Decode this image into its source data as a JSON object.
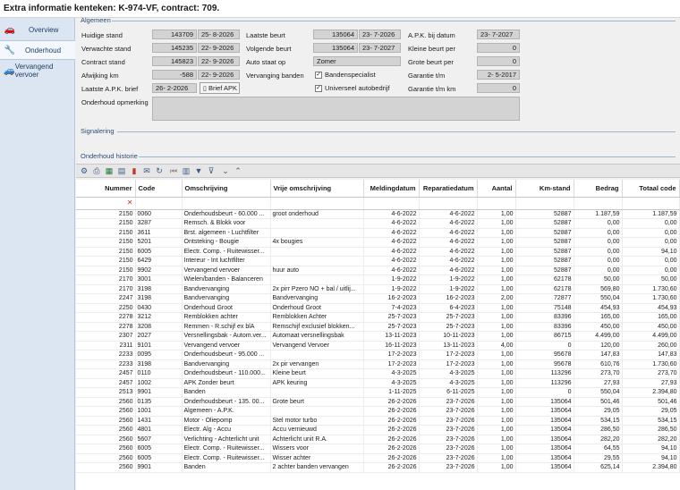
{
  "window": {
    "title": "Extra informatie kenteken: K-974-VF, contract: 709."
  },
  "sidebar": {
    "items": [
      {
        "label": "Overview",
        "icon": "car-icon"
      },
      {
        "label": "Onderhoud",
        "icon": "wrench-icon"
      },
      {
        "label": "Vervangend vervoer",
        "icon": "car-swap-icon"
      }
    ]
  },
  "algemeen": {
    "title": "Algemeen",
    "huidige_stand": {
      "label": "Huidige stand",
      "value": "143709",
      "date": "25- 8-2026"
    },
    "verwachte_stand": {
      "label": "Verwachte stand",
      "value": "145235",
      "date": "22- 9-2026"
    },
    "contract_stand": {
      "label": "Contract stand",
      "value": "145823",
      "date": "22- 9-2026"
    },
    "afwijking_km": {
      "label": "Afwijking km",
      "value": "-588",
      "date": "22- 9-2026"
    },
    "laatste_apk_brief": {
      "label": "Laatste A.P.K. brief",
      "date": "26- 2-2026",
      "button": "Brief APK"
    },
    "laatste_beurt": {
      "label": "Laatste beurt",
      "value": "135064",
      "date": "23- 7-2026"
    },
    "volgende_beurt": {
      "label": "Volgende beurt",
      "value": "135064",
      "date": "23- 7-2027"
    },
    "auto_staat_op": {
      "label": "Auto staat op",
      "value": "Zomer"
    },
    "vervanging_banden": {
      "label": "Vervanging banden",
      "bandenspecialist": "Bandenspecialist",
      "universeel": "Universeel autobedrijf"
    },
    "apk_bij_datum": {
      "label": "A.P.K. bij datum",
      "date": "23- 7-2027"
    },
    "kleine_beurt_per": {
      "label": "Kleine beurt per",
      "value": "0"
    },
    "grote_beurt_per": {
      "label": "Grote beurt per",
      "value": "0"
    },
    "garantie_tm": {
      "label": "Garantie t/m",
      "date": "2- 5-2017"
    },
    "garantie_tm_km": {
      "label": "Garantie t/m km",
      "value": "0"
    },
    "onderhoud_opmerking": {
      "label": "Onderhoud opmerking",
      "value": ""
    }
  },
  "signalering": {
    "title": "Signalering"
  },
  "historie": {
    "title": "Onderhoud historie",
    "columns": [
      "Nummer",
      "Code",
      "Omschrijving",
      "Vrije omschrijving",
      "Meldingdatum",
      "Reparatiedatum",
      "Aantal",
      "Km-stand",
      "Bedrag",
      "Totaal code"
    ],
    "rows": [
      [
        "2150",
        "0060",
        "Onderhoudsbeurt - 60.000 ...",
        "groot onderhoud",
        "4-6-2022",
        "4-6-2022",
        "1,00",
        "52887",
        "1.187,59",
        "1.187,59"
      ],
      [
        "2150",
        "3287",
        "Remsch. & Blokk voor",
        "",
        "4-6-2022",
        "4-6-2022",
        "1,00",
        "52887",
        "0,00",
        "0,00"
      ],
      [
        "2150",
        "3611",
        "Brst. algemeen - Luchtfilter",
        "",
        "4-6-2022",
        "4-6-2022",
        "1,00",
        "52887",
        "0,00",
        "0,00"
      ],
      [
        "2150",
        "5201",
        "Ontsteking - Bougie",
        "4x bougies",
        "4-6-2022",
        "4-6-2022",
        "1,00",
        "52887",
        "0,00",
        "0,00"
      ],
      [
        "2150",
        "6005",
        "Electr. Comp. - Ruitewisser...",
        "",
        "4-6-2022",
        "4-6-2022",
        "1,00",
        "52887",
        "0,00",
        "94,10"
      ],
      [
        "2150",
        "6429",
        "Intereur - Int luchtfilter",
        "",
        "4-6-2022",
        "4-6-2022",
        "1,00",
        "52887",
        "0,00",
        "0,00"
      ],
      [
        "2150",
        "9902",
        "Vervangend vervoer",
        "huur auto",
        "4-6-2022",
        "4-6-2022",
        "1,00",
        "52887",
        "0,00",
        "0,00"
      ],
      [
        "2170",
        "3001",
        "Wielen/banden - Balanceren",
        "",
        "1-9-2022",
        "1-9-2022",
        "1,00",
        "62178",
        "50,00",
        "50,00"
      ],
      [
        "2170",
        "3198",
        "Bandvervanging",
        "2x pirr Pzero NO + bal / uitlij...",
        "1-9-2022",
        "1-9-2022",
        "1,00",
        "62178",
        "569,80",
        "1.730,60"
      ],
      [
        "2247",
        "3198",
        "Bandvervanging",
        "Bandvervanging",
        "16-2-2023",
        "16-2-2023",
        "2,00",
        "72877",
        "550,04",
        "1.730,60"
      ],
      [
        "2250",
        "0430",
        "Onderhoud Groot",
        "Onderhoud Groot",
        "7-4-2023",
        "6-4-2023",
        "1,00",
        "75148",
        "454,93",
        "454,93"
      ],
      [
        "2278",
        "3212",
        "Remblokken achter",
        "Remblokken Achter",
        "25-7-2023",
        "25-7-2023",
        "1,00",
        "83396",
        "165,00",
        "165,00"
      ],
      [
        "2278",
        "3208",
        "Remmen - R.schijf ex blA",
        "Remschijf exclusief blokken...",
        "25-7-2023",
        "25-7-2023",
        "1,00",
        "83396",
        "450,00",
        "450,00"
      ],
      [
        "2307",
        "2027",
        "Versnellingsbak - Autom.ver...",
        "Automaat versnellingsbak",
        "13-11-2023",
        "10-11-2023",
        "1,00",
        "86715",
        "4.499,00",
        "4.499,00"
      ],
      [
        "2311",
        "9101",
        "Vervangend vervoer",
        "Vervangend Vervoer",
        "16-11-2023",
        "13-11-2023",
        "4,00",
        "0",
        "120,00",
        "260,00"
      ],
      [
        "2233",
        "0095",
        "Onderhoudsbeurt - 95.000 ...",
        "",
        "17-2-2023",
        "17-2-2023",
        "1,00",
        "95678",
        "147,83",
        "147,83"
      ],
      [
        "2233",
        "3198",
        "Bandvervanging",
        "2x pir vervangen",
        "17-2-2023",
        "17-2-2023",
        "1,00",
        "95678",
        "610,76",
        "1.730,60"
      ],
      [
        "2457",
        "0110",
        "Onderhoudsbeurt - 110.000...",
        "Kleine beurt",
        "4-3-2025",
        "4-3-2025",
        "1,00",
        "113296",
        "273,70",
        "273,70"
      ],
      [
        "2457",
        "1002",
        "APK Zonder beurt",
        "APK keuring",
        "4-3-2025",
        "4-3-2025",
        "1,00",
        "113296",
        "27,93",
        "27,93"
      ],
      [
        "2513",
        "9901",
        "Banden",
        "",
        "1-11-2025",
        "6-11-2025",
        "1,00",
        "0",
        "550,04",
        "2.394,80"
      ],
      [
        "2560",
        "0135",
        "Onderhoudsbeurt - 135. 00...",
        "Grote beurt",
        "26-2-2026",
        "23-7-2026",
        "1,00",
        "135064",
        "501,46",
        "501,46"
      ],
      [
        "2560",
        "1001",
        "Algemeen - A.P.K.",
        "",
        "26-2-2026",
        "23-7-2026",
        "1,00",
        "135064",
        "29,05",
        "29,05"
      ],
      [
        "2560",
        "1431",
        "Motor - Oliepomp",
        "Stel motor turbo",
        "26-2-2026",
        "23-7-2026",
        "1,00",
        "135064",
        "534,15",
        "534,15"
      ],
      [
        "2560",
        "4801",
        "Electr. Alg - Accu",
        "Accu vernieuwd",
        "26-2-2026",
        "23-7-2026",
        "1,00",
        "135064",
        "286,50",
        "286,50"
      ],
      [
        "2560",
        "5607",
        "Verlichting - Achterlicht unit",
        "Achterlicht unit R.A.",
        "26-2-2026",
        "23-7-2026",
        "1,00",
        "135064",
        "282,20",
        "282,20"
      ],
      [
        "2560",
        "6005",
        "Electr. Comp. - Ruitewisser...",
        "Wissers voor",
        "26-2-2026",
        "23-7-2026",
        "1,00",
        "135064",
        "64,55",
        "94,10"
      ],
      [
        "2560",
        "6005",
        "Electr. Comp. - Ruitewisser...",
        "Wisser achter",
        "26-2-2026",
        "23-7-2026",
        "1,00",
        "135064",
        "29,55",
        "94,10"
      ],
      [
        "2560",
        "9901",
        "Banden",
        "2 achter banden vervangen",
        "26-2-2026",
        "23-7-2026",
        "1,00",
        "135064",
        "625,14",
        "2.394,80"
      ]
    ]
  },
  "toolbar": {
    "icons": [
      "settings-icon",
      "print-icon",
      "excel-icon",
      "export-icon",
      "pdf-icon",
      "mail-icon",
      "refresh-icon",
      "first-icon",
      "columns-icon",
      "filter-icon",
      "clear-filter-icon",
      "collapse-icon",
      "expand-icon"
    ]
  }
}
